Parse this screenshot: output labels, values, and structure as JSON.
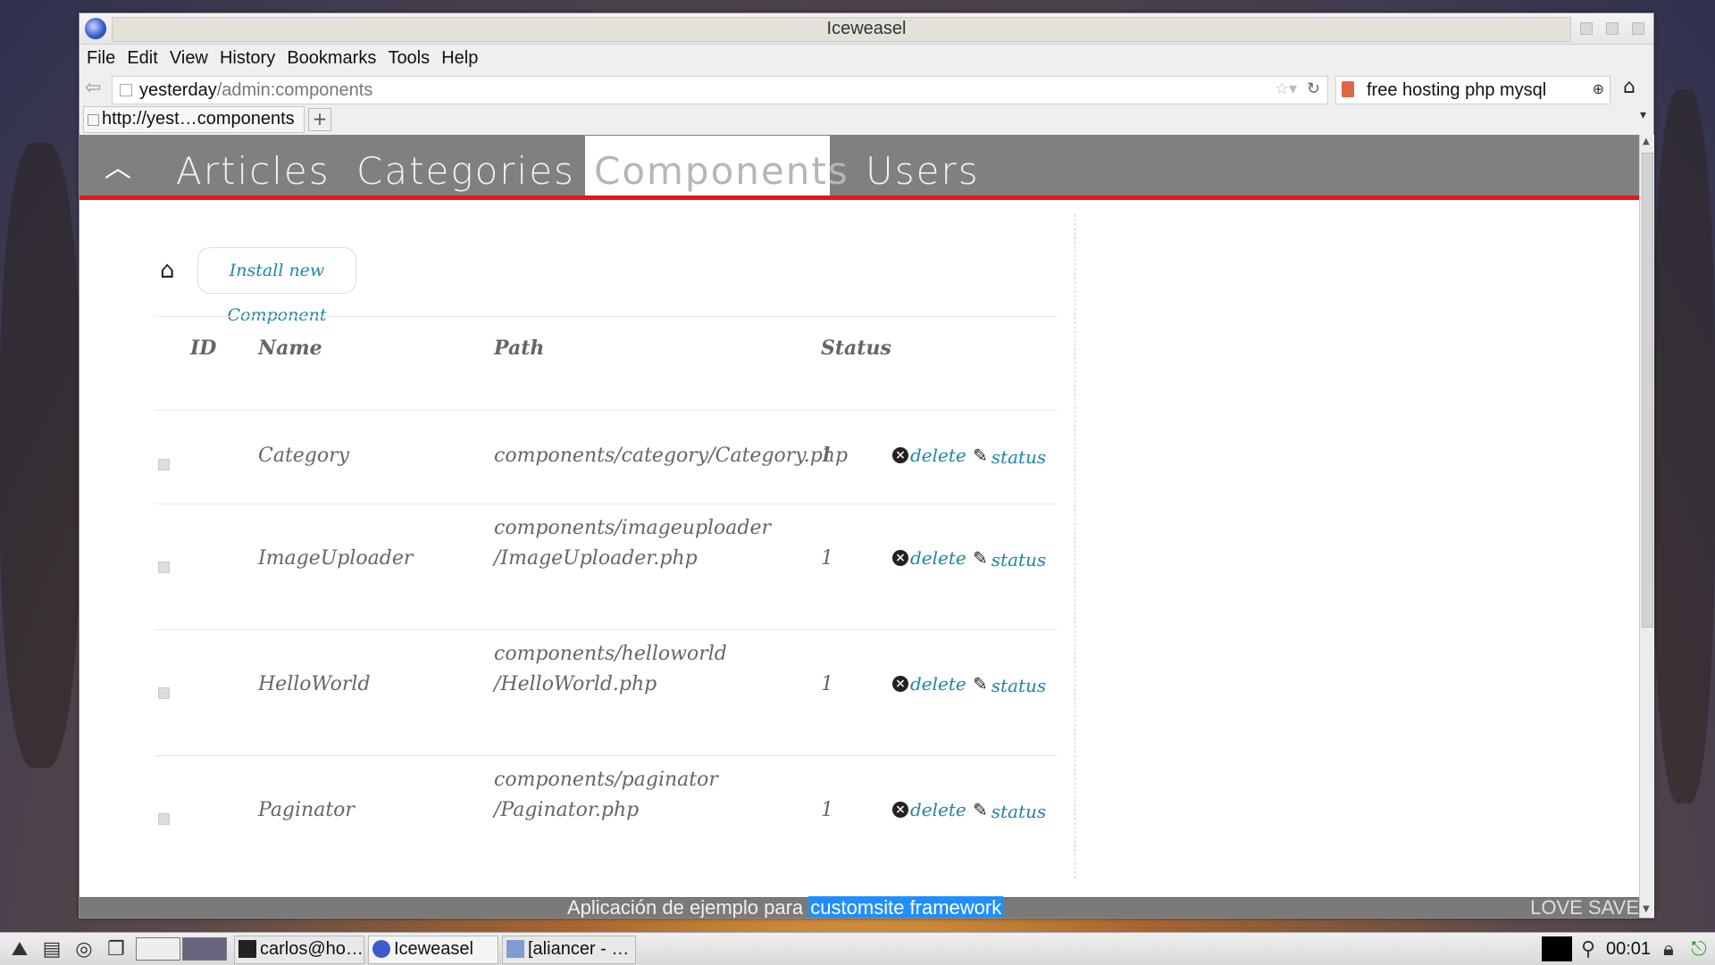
{
  "window": {
    "title": "Iceweasel"
  },
  "menubar": [
    "File",
    "Edit",
    "View",
    "History",
    "Bookmarks",
    "Tools",
    "Help"
  ],
  "urlbar": {
    "host": "yesterday",
    "path": "/admin:components"
  },
  "searchbar": {
    "value": "free hosting php mysql"
  },
  "tab": {
    "label": "http://yest…components"
  },
  "site_nav": {
    "tabs": [
      "Articles",
      "Categories",
      "Components",
      "Users"
    ],
    "active": "Components"
  },
  "toolbar": {
    "install_label": "Install new Component"
  },
  "table": {
    "headers": [
      "ID",
      "Name",
      "Path",
      "Status"
    ],
    "rows": [
      {
        "id": "",
        "name": "Category",
        "path_line1": "components/category/Category.php",
        "path_line2": "",
        "status": "1",
        "delete_label": "delete",
        "status_label": "status"
      },
      {
        "id": "",
        "name": "ImageUploader",
        "path_line1": "components/imageuploader",
        "path_line2": "/ImageUploader.php",
        "status": "1",
        "delete_label": "delete",
        "status_label": "status"
      },
      {
        "id": "",
        "name": "HelloWorld",
        "path_line1": "components/helloworld",
        "path_line2": "/HelloWorld.php",
        "status": "1",
        "delete_label": "delete",
        "status_label": "status"
      },
      {
        "id": "",
        "name": "Paginator",
        "path_line1": "components/paginator",
        "path_line2": "/Paginator.php",
        "status": "1",
        "delete_label": "delete",
        "status_label": "status"
      }
    ]
  },
  "footer": {
    "text": "Aplicación de ejemplo para",
    "link": "customsite framework",
    "right": "LOVE SAVE"
  },
  "taskbar": {
    "tasks": [
      "carlos@ho…",
      "Iceweasel",
      "[aliancer - …"
    ],
    "clock": "00:01"
  },
  "colors": {
    "accent_red": "#e21818",
    "link": "#1b87a8",
    "nav_gray": "#808080",
    "footer_link_bg": "#1f8fff"
  }
}
